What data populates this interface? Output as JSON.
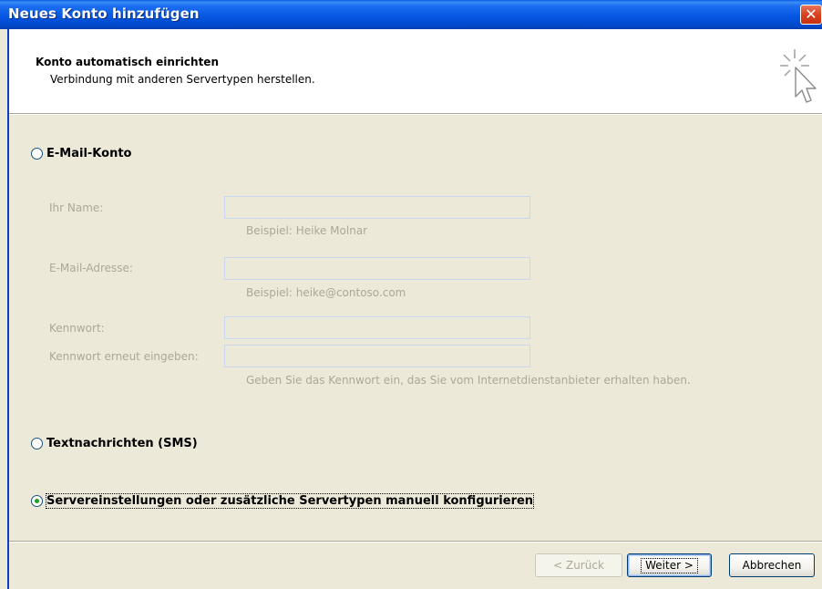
{
  "window": {
    "title": "Neues Konto hinzufügen",
    "close_glyph": "✕"
  },
  "header": {
    "title": "Konto automatisch einrichten",
    "subtitle": "Verbindung mit anderen Servertypen herstellen.",
    "icon": "cursor-sparkle-icon"
  },
  "options": {
    "email": {
      "label": "E-Mail-Konto",
      "selected": false
    },
    "sms": {
      "label": "Textnachrichten (SMS)",
      "selected": false
    },
    "manual": {
      "label": "Servereinstellungen oder zusätzliche Servertypen manuell konfigurieren",
      "selected": true
    }
  },
  "form": {
    "name_label": "Ihr Name:",
    "name_value": "",
    "name_hint": "Beispiel: Heike Molnar",
    "email_label": "E-Mail-Adresse:",
    "email_value": "",
    "email_hint": "Beispiel: heike@contoso.com",
    "password_label": "Kennwort:",
    "password_value": "",
    "password_repeat_label": "Kennwort erneut eingeben:",
    "password_repeat_value": "",
    "password_hint": "Geben Sie das Kennwort ein, das Sie vom Internetdienstanbieter erhalten haben."
  },
  "buttons": {
    "back": "< Zurück",
    "next": "Weiter >",
    "cancel": "Abbrechen"
  },
  "colors": {
    "title_bar": "#0355e0",
    "face": "#ece9d8",
    "disabled_text": "#aca899",
    "radio_check": "#21a121"
  }
}
